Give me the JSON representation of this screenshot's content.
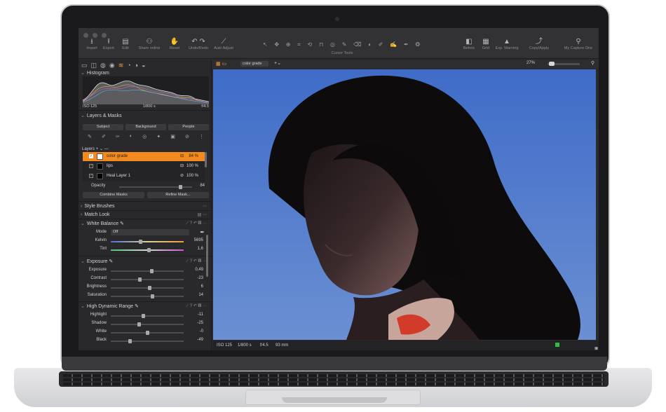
{
  "toolbar": {
    "buttons_left": [
      {
        "label": "Import",
        "icon": "import-icon"
      },
      {
        "label": "Export",
        "icon": "export-icon"
      },
      {
        "label": "Edit",
        "icon": "edit-icon"
      },
      {
        "label": "Share online",
        "icon": "share-icon"
      },
      {
        "label": "Reset",
        "icon": "reset-icon"
      },
      {
        "label": "Undo/Redo",
        "icon": "undo-redo-icon"
      },
      {
        "label": "Auto Adjust",
        "icon": "wand-icon"
      }
    ],
    "cursor_tools_label": "Cursor Tools",
    "buttons_right": [
      {
        "label": "Before",
        "icon": "before-icon"
      },
      {
        "label": "Grid",
        "icon": "grid-icon"
      },
      {
        "label": "Exp. Warning",
        "icon": "warning-icon"
      },
      {
        "label": "Copy/Apply",
        "icon": "copy-apply-icon"
      },
      {
        "label": "My Capture One",
        "icon": "account-icon"
      }
    ]
  },
  "histogram": {
    "title": "Histogram",
    "iso": "ISO 125",
    "shutter": "1/800 s",
    "aperture": "f/4.5"
  },
  "layers_masks": {
    "title": "Layers & Masks",
    "mask_buttons": [
      "Subject",
      "Background",
      "People"
    ],
    "layers_label": "Layers",
    "layers": [
      {
        "name": "color grade",
        "opacity": "84 %",
        "selected": true
      },
      {
        "name": "lips",
        "opacity": "100 %",
        "selected": false
      },
      {
        "name": "Heal Layer 1",
        "opacity": "100 %",
        "selected": false
      }
    ],
    "opacity_label": "Opacity",
    "opacity_value": "84",
    "opacity_fraction": 0.84,
    "combine_label": "Combine Masks",
    "refine_label": "Refine Mask..."
  },
  "tools": {
    "style_brushes": "Style Brushes",
    "match_look": "Match Look",
    "white_balance": {
      "title": "White Balance",
      "mode_label": "Mode",
      "mode_value": "Off",
      "kelvin_label": "Kelvin",
      "kelvin_value": "5695",
      "kelvin_fraction": 0.4,
      "tint_label": "Tint",
      "tint_value": "1,6",
      "tint_fraction": 0.52
    },
    "exposure": {
      "title": "Exposure",
      "rows": [
        {
          "label": "Exposure",
          "value": "0,49",
          "fraction": 0.56
        },
        {
          "label": "Contrast",
          "value": "-23",
          "fraction": 0.39
        },
        {
          "label": "Brightness",
          "value": "6",
          "fraction": 0.53
        },
        {
          "label": "Saturation",
          "value": "14",
          "fraction": 0.57
        }
      ]
    },
    "hdr": {
      "title": "High Dynamic Range",
      "rows": [
        {
          "label": "Highlight",
          "value": "-11",
          "fraction": 0.44
        },
        {
          "label": "Shadow",
          "value": "-25",
          "fraction": 0.38
        },
        {
          "label": "White",
          "value": "-0",
          "fraction": 0.5
        },
        {
          "label": "Black",
          "value": "-49",
          "fraction": 0.26
        }
      ]
    }
  },
  "viewer": {
    "variant": "color grade",
    "zoom": "27%",
    "caption": {
      "iso": "ISO 125",
      "shutter": "1/800 s",
      "aperture": "f/4.5",
      "focal": "93 mm"
    },
    "rating_stars": "★★★★",
    "rating_dots": "·"
  },
  "colors": {
    "accent": "#f28a1f",
    "sky": "#4f78c9",
    "color_tag": "#28c23f"
  }
}
